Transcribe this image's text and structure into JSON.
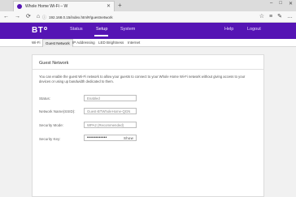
{
  "browser": {
    "tab_title": "Whole Home Wi-Fi – W",
    "tab_close": "✕",
    "new_tab": "+",
    "url": "192.168.0.15/index.html#/guestnetwork",
    "back_glyph": "←",
    "forward_glyph": "→",
    "reload_glyph": "⟳",
    "home_glyph": "⌂",
    "tools": [
      "☆",
      "≡",
      "✎",
      "…"
    ]
  },
  "header": {
    "logo": "BT",
    "nav": [
      "Status",
      "Setup",
      "System",
      "Help",
      "Logout"
    ],
    "active_nav": "Setup"
  },
  "subnav": {
    "items": [
      "Wi-Fi",
      "Guest Network",
      "IP Addressing",
      "LED Brightness",
      "Internet"
    ],
    "active": "Guest Network"
  },
  "guest_network": {
    "title": "Guest Network",
    "description": "You can enable the guest Wi-Fi network to allow your guests to connect to your Whole Home Wi-Fi network without giving access to your devices or using up bandwidth dedicated to them.",
    "status_label": "Status:",
    "status_value": "Enabled",
    "name_label": "Network Name(SSID):",
    "name_value": "Guest-BTWholeHome-QGN",
    "mode_label": "Security Mode:",
    "mode_value": "WPA2 (Recommended)",
    "key_label": "Security Key:",
    "key_value": "••••••••••••",
    "show_label": "Show"
  },
  "colors": {
    "brand": "#5514b4",
    "background": "#f1f1f1"
  }
}
